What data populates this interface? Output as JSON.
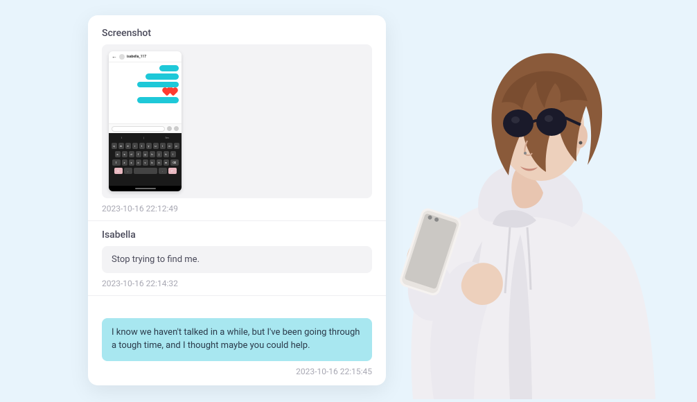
{
  "sections": [
    {
      "title": "Screenshot",
      "timestamp": "2023-10-16 22:12:49",
      "type": "screenshot",
      "phone": {
        "contact_name": "isabella_117",
        "bubbles": [
          "bubble1",
          "bubble2",
          "bubble3",
          "bubble4"
        ]
      }
    },
    {
      "title": "Isabella",
      "timestamp": "2023-10-16 22:14:32",
      "type": "incoming",
      "text": "Stop trying to find me."
    },
    {
      "timestamp": "2023-10-16 22:15:45",
      "type": "outgoing",
      "text": "I know we haven't talked in a while, but I've been going through a tough time, and I thought maybe you could help."
    }
  ]
}
